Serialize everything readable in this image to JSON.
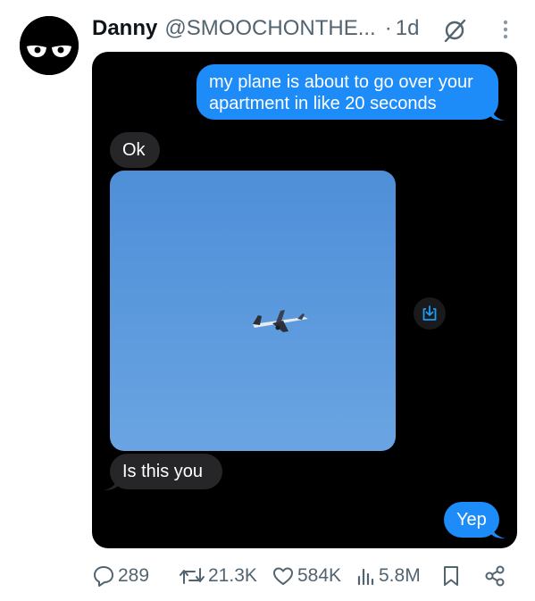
{
  "post": {
    "author_name": "Danny",
    "author_handle": "@SMOOCHONTHE...",
    "separator": "·",
    "time": "1d"
  },
  "messages": [
    {
      "side": "sent",
      "text": "my plane is about to go over your apartment in like 20 seconds"
    },
    {
      "side": "received",
      "text": "Ok"
    },
    {
      "side": "received",
      "type": "image",
      "content": "airplane in blue sky"
    },
    {
      "side": "received",
      "text": "Is this you"
    },
    {
      "side": "sent",
      "text": "Yep"
    }
  ],
  "actions": {
    "replies": "289",
    "reposts": "21.3K",
    "likes": "584K",
    "views": "5.8M"
  },
  "colors": {
    "sent_bubble": "#1d8cf8",
    "received_bubble": "#262628",
    "chat_background": "#000000",
    "meta_text": "#536471"
  },
  "icons": [
    "mute-icon",
    "more-icon",
    "save-image-icon",
    "reply-icon",
    "repost-icon",
    "like-icon",
    "views-icon",
    "bookmark-icon",
    "share-icon"
  ]
}
